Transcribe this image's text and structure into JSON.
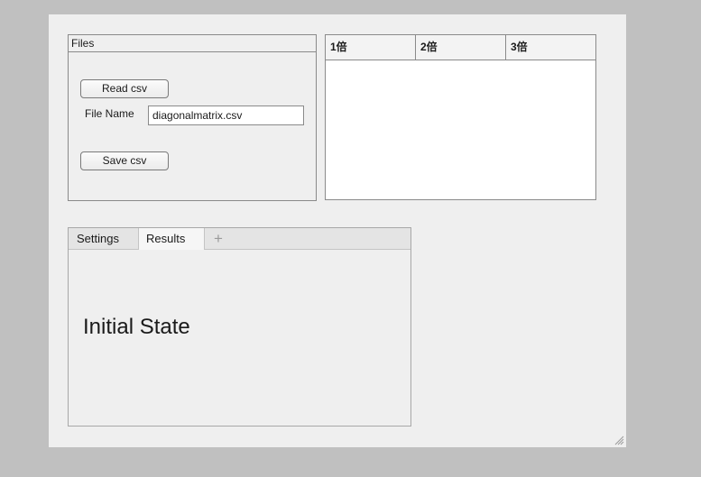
{
  "files_panel": {
    "title": "Files",
    "read_label": "Read csv",
    "filename_label": "File Name",
    "filename_value": "diagonalmatrix.csv",
    "save_label": "Save csv"
  },
  "table": {
    "columns": [
      "1倍",
      "2倍",
      "3倍"
    ],
    "rows": []
  },
  "tabs": {
    "items": [
      {
        "label": "Settings"
      },
      {
        "label": "Results"
      }
    ],
    "add_glyph": "+",
    "active": "Results"
  },
  "results": {
    "status_text": "Initial State"
  },
  "icons": {
    "add_tab": "plus-icon",
    "resize": "resize-grip-icon"
  }
}
